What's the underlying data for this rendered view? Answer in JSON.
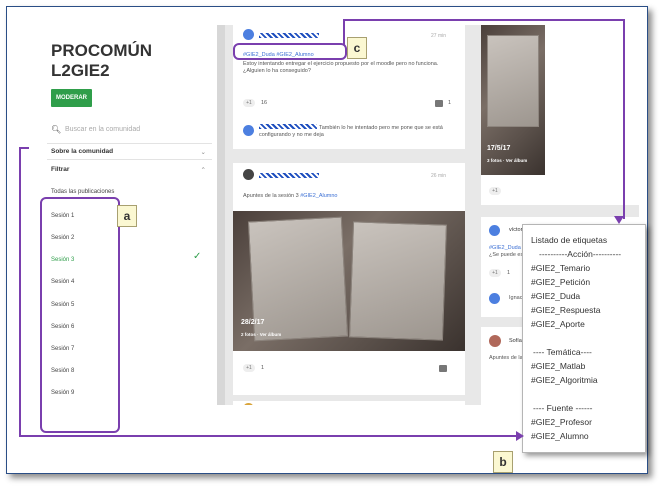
{
  "sidebar": {
    "title_line1": "PROCOMÚN",
    "title_line2": "L2GIE2",
    "moderate_button": "MODERAR",
    "search_placeholder": "Buscar en la comunidad",
    "about_label": "Sobre la comunidad",
    "filter_label": "Filtrar",
    "all_posts": "Todas las publicaciones",
    "sessions": [
      "Sesión 1",
      "Sesión 2",
      "Sesión 3",
      "Sesión 4",
      "Sesión 5",
      "Sesión 6",
      "Sesión 7",
      "Sesión 8",
      "Sesión 9"
    ],
    "active_session_index": 2
  },
  "feed": {
    "post1": {
      "time": "27 min",
      "tags": "#GIE2_Duda #GIE2_Alumno",
      "text": "Estoy intentando entregar el ejercicio propuesto por el moodle pero no funciona. ¿Alguien lo ha conseguido?",
      "likes": "16",
      "comments": "1",
      "reply": "También lo he intentado pero me pone que se está configurando y no me deja"
    },
    "post2": {
      "time": "26 min",
      "text": "Apuntes de la sesión 3",
      "tag": "#GIE2_Alumno",
      "photo_date": "28/2/17",
      "photo_sub": "2 fotos · Ver álbum",
      "likes": "1"
    }
  },
  "right_column": {
    "photo_date": "17/5/17",
    "photo_sub": "3 fotos · Ver álbum",
    "user1": "víctor",
    "user1_tag": "#GIE2_Duda",
    "user1_text": "¿Se puede es",
    "likes": "1",
    "user2": "Ignaci",
    "user3": "Sofía",
    "user3_text": "Apuntes de la"
  },
  "tag_popup": {
    "title": "Listado de etiquetas",
    "action_header": "----------Acción----------",
    "action_tags": [
      "#GIE2_Temario",
      "#GIE2_Petición",
      "#GIE2_Duda",
      "#GIE2_Respuesta",
      "#GIE2_Aporte"
    ],
    "theme_header": "---- Temática----",
    "theme_tags": [
      "#GIE2_Matlab",
      "#GIE2_Algoritmia"
    ],
    "source_header": "---- Fuente ------",
    "source_tags": [
      "#GIE2_Profesor",
      "#GIE2_Alumno"
    ]
  },
  "annotations": {
    "a": "a",
    "b": "b",
    "c": "c"
  },
  "colors": {
    "accent_green": "#2f9e4a",
    "annotation_purple": "#7a3fae",
    "frame_blue": "#2a4e86"
  }
}
